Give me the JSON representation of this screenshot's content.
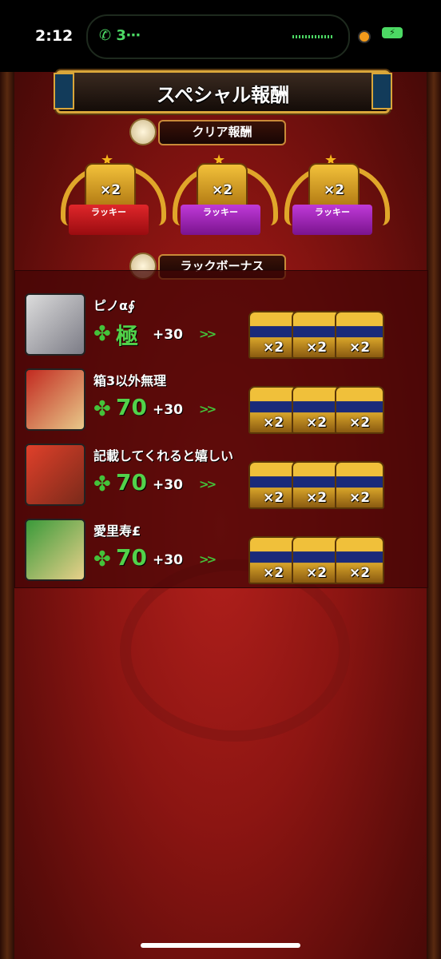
{
  "status_bar": {
    "time": "2:12",
    "call": "3⋯"
  },
  "title": "スペシャル報酬",
  "clear_reward": {
    "label": "クリア報酬",
    "items": [
      {
        "count": "×2",
        "ribbon": "ラッキー",
        "color": "#d8202a"
      },
      {
        "count": "×2",
        "ribbon": "ラッキー",
        "color": "#b22ad0"
      },
      {
        "count": "×2",
        "ribbon": "ラッキー",
        "color": "#b22ad0"
      }
    ]
  },
  "luck_bonus": {
    "label": "ラックボーナス",
    "players": [
      {
        "name": "ピノα∮",
        "luck": "極",
        "bonus": "+30",
        "arrow": ">>",
        "chests": [
          "×2",
          "×2",
          "×2"
        ]
      },
      {
        "name": "箱3以外無理",
        "luck": "70",
        "bonus": "+30",
        "arrow": ">>",
        "chests": [
          "×2",
          "×2",
          "×2"
        ]
      },
      {
        "name": "記載してくれると嬉しい",
        "luck": "70",
        "bonus": "+30",
        "arrow": ">>",
        "chests": [
          "×2",
          "×2",
          "×2"
        ]
      },
      {
        "name": "愛里寿£",
        "luck": "70",
        "bonus": "+30",
        "arrow": ">>",
        "chests": [
          "×2",
          "×2",
          "×2"
        ]
      }
    ]
  },
  "icons": {
    "clover": "✤",
    "star": "★"
  },
  "colors": {
    "gold": "#d9a63a",
    "green": "#52d24a",
    "bg_red": "#8c1512"
  }
}
